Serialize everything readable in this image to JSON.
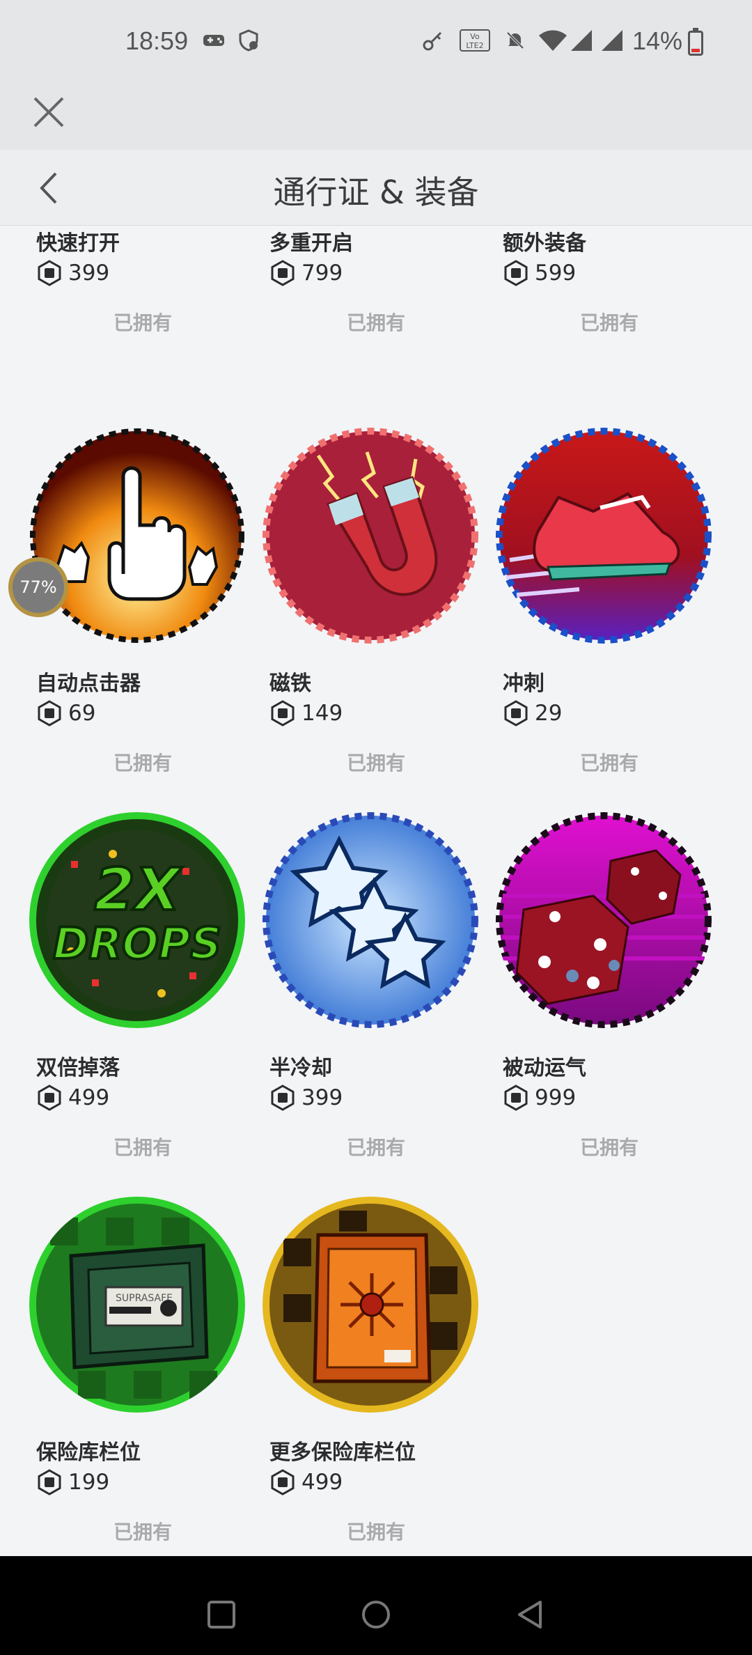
{
  "status_bar": {
    "time": "18:59",
    "battery": "14%",
    "icons": [
      "gamepad-icon",
      "shield-icon",
      "key-icon",
      "volte-icon",
      "mute-icon",
      "wifi-icon",
      "signal-icon",
      "signal-icon",
      "battery-icon"
    ],
    "volte_text": "Vo LTE 2"
  },
  "header": {
    "title": "通行证 & 装备",
    "close_icon": "close-icon",
    "back_icon": "chevron-left-icon"
  },
  "owned_label": "已拥有",
  "progress_overlay": "77%",
  "items": [
    {
      "name": "快速打开",
      "price": "399",
      "owned": "已拥有",
      "icon": "fast-open-icon"
    },
    {
      "name": "多重开启",
      "price": "799",
      "owned": "已拥有",
      "icon": "multi-open-icon"
    },
    {
      "name": "额外装备",
      "price": "599",
      "owned": "已拥有",
      "icon": "extra-equip-icon"
    },
    {
      "name": "自动点击器",
      "price": "69",
      "owned": "已拥有",
      "icon": "auto-clicker-icon"
    },
    {
      "name": "磁铁",
      "price": "149",
      "owned": "已拥有",
      "icon": "magnet-icon"
    },
    {
      "name": "冲刺",
      "price": "29",
      "owned": "已拥有",
      "icon": "sprint-shoe-icon"
    },
    {
      "name": "双倍掉落",
      "price": "499",
      "owned": "已拥有",
      "icon": "double-drops-icon",
      "badge_text_1": "2X",
      "badge_text_2": "DROPS"
    },
    {
      "name": "半冷却",
      "price": "399",
      "owned": "已拥有",
      "icon": "half-cooldown-stars-icon"
    },
    {
      "name": "被动运气",
      "price": "999",
      "owned": "已拥有",
      "icon": "passive-luck-dice-icon"
    },
    {
      "name": "保险库栏位",
      "price": "199",
      "owned": "已拥有",
      "icon": "vault-slot-icon",
      "badge_text_1": "SUPRASAFE"
    },
    {
      "name": "更多保险库栏位",
      "price": "499",
      "owned": "已拥有",
      "icon": "more-vault-slots-icon"
    }
  ],
  "colors": {
    "background": "#f2f4f6",
    "owned_text": "#a8aaac",
    "header_bg": "#eceef0"
  },
  "nav": {
    "recent_icon": "square-recent-icon",
    "home_icon": "circle-home-icon",
    "back_icon": "triangle-back-icon"
  }
}
